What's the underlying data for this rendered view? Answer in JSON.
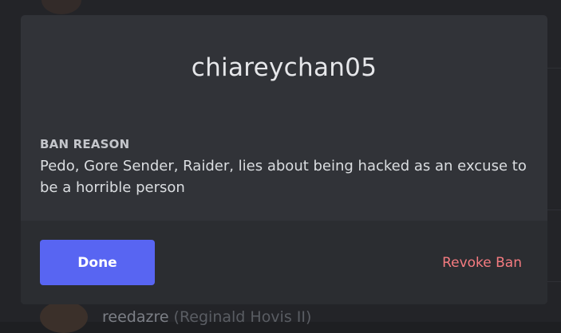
{
  "background": {
    "member_name": "reedazre",
    "member_nickname": "(Reginald Hovis II)"
  },
  "modal": {
    "title": "chiareychan05",
    "ban_reason_label": "BAN REASON",
    "ban_reason_text": "Pedo, Gore Sender, Raider, lies about being hacked as an excuse to be a horrible person",
    "done_label": "Done",
    "revoke_label": "Revoke Ban"
  },
  "colors": {
    "primary_button": "#5865f2",
    "danger_text": "#f57b80",
    "modal_bg": "#313338",
    "footer_bg": "#2b2d31"
  }
}
